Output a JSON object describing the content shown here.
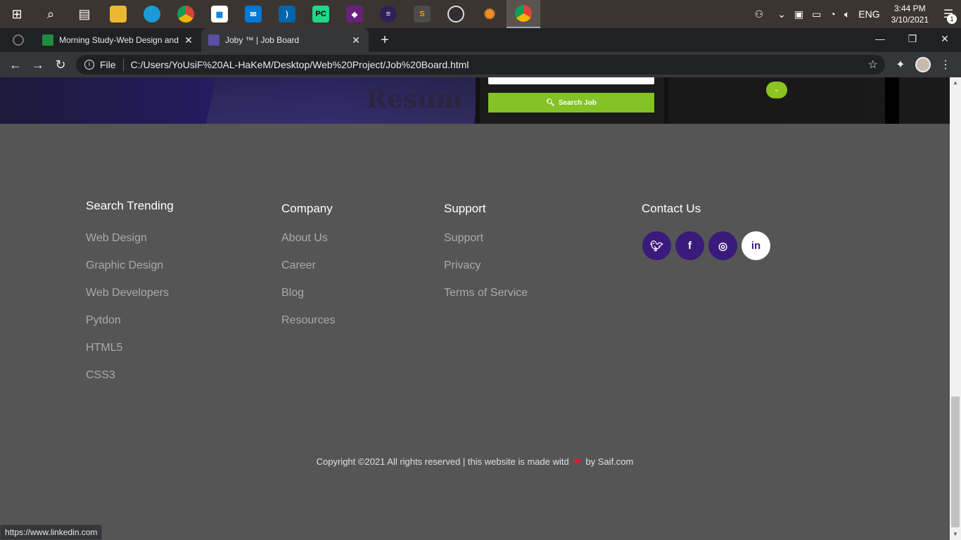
{
  "taskbar": {
    "time": "3:44 PM",
    "date": "3/10/2021",
    "lang": "ENG",
    "notifications": "1"
  },
  "tabs": [
    {
      "title": "Morning Study-Web Design and",
      "active": false
    },
    {
      "title": "Joby ™ | Job Board",
      "active": true
    }
  ],
  "address": {
    "scheme": "File",
    "url": "C:/Users/YoUsiF%20AL-HaKeM/Desktop/Web%20Project/Job%20Board.html"
  },
  "hero": {
    "search_button": "Search Job",
    "paper_text": "Resum"
  },
  "footer": {
    "columns": [
      {
        "title": "Search Trending",
        "items": [
          "Web Design",
          "Graphic Design",
          "Web Developers",
          "Pytdon",
          "HTML5",
          "CSS3"
        ]
      },
      {
        "title": "Company",
        "items": [
          "About Us",
          "Career",
          "Blog",
          "Resources"
        ]
      },
      {
        "title": "Support",
        "items": [
          "Support",
          "Privacy",
          "Terms of Service"
        ]
      },
      {
        "title": "Contact Us",
        "social": [
          "twitter-icon",
          "facebook-icon",
          "instagram-icon",
          "linkedin-icon"
        ]
      }
    ],
    "copyright_before": "Copyright ©2021 All rights reserved | this website is made witd",
    "copyright_after": "by Saif.com"
  },
  "status_url": "https://www.linkedin.com",
  "colors": {
    "footer_bg": "#555555",
    "social_bg": "#3a1a7a",
    "accent_green": "#84c225",
    "heart": "#e21b2b"
  }
}
